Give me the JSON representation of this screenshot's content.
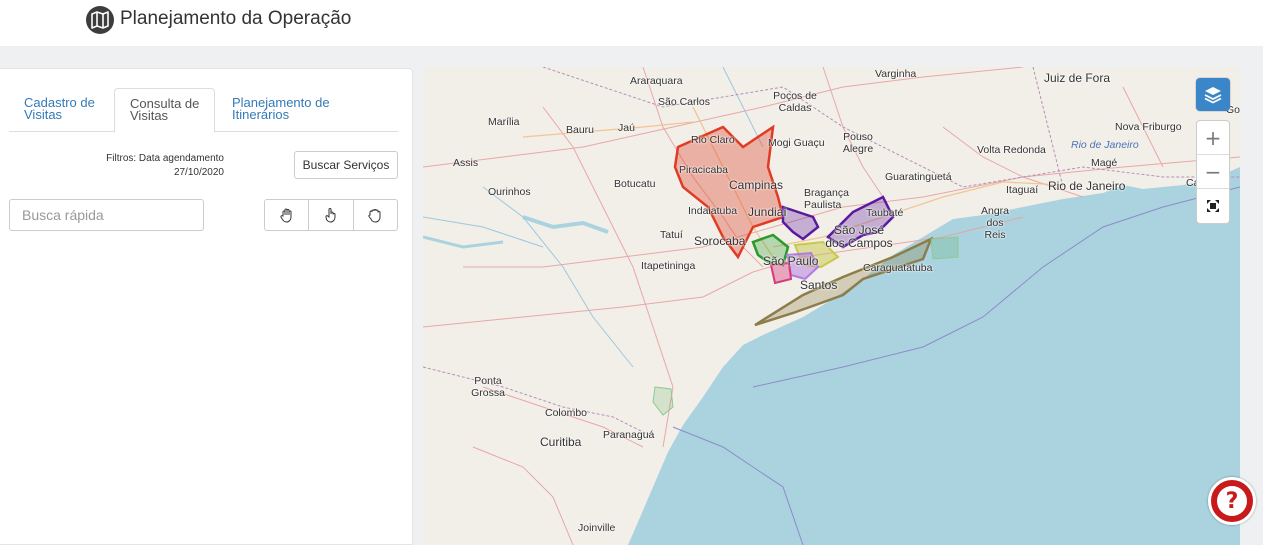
{
  "header": {
    "title": "Planejamento da Operação",
    "logo_icon": "map-book-icon"
  },
  "tabs": [
    {
      "label": "Cadastro de Visitas",
      "active": false
    },
    {
      "label": "Consulta de Visitas",
      "active": true
    },
    {
      "label": "Planejamento de Itinerários",
      "active": false
    }
  ],
  "filters": {
    "label": "Filtros: Data agendamento",
    "date": "27/10/2020"
  },
  "buttons": {
    "buscar_servicos": "Buscar Serviços"
  },
  "search": {
    "placeholder": "Busca rápida",
    "value": ""
  },
  "tool_icons": [
    "hand-open-icon",
    "hand-pointer-icon",
    "hand-grab-icon"
  ],
  "map": {
    "labels": [
      "Varginha",
      "Juiz de Fora",
      "Araraquara",
      "São Carlos",
      "Poços de Caldas",
      "Marília",
      "Bauru",
      "Jaú",
      "Rio Claro",
      "Mogi Guaçu",
      "Pouso Alegre",
      "Nova Friburgo",
      "Volta Redonda",
      "Rio de Janeiro",
      "Magé",
      "Assis",
      "Piracicaba",
      "Campinas",
      "Guaratinguetá",
      "Ourinhos",
      "Botucatu",
      "Bragança Paulista",
      "Itaguaí",
      "Rio de Janeiro",
      "Cabo",
      "Indaiatuba",
      "Jundiaí",
      "Taubaté",
      "Angra dos Reis",
      "Tatuí",
      "São José dos Campos",
      "Sorocaba",
      "Itapetininga",
      "São Paulo",
      "Caraguatatuba",
      "Santos",
      "Ponta Grossa",
      "Colombo",
      "Curitiba",
      "Paranaguá",
      "Joinville",
      "Goy"
    ],
    "zoom_in": "+",
    "zoom_out": "−",
    "colors": {
      "ocean": "#aad3df",
      "land": "#f2efe9",
      "red_region": "#e03b24",
      "purple_region": "#5b1a9e",
      "green_region": "#2a9a2a",
      "olive_region": "#8c7d4a",
      "lilac_region": "#b07ae0",
      "yellow_region": "#c8c84a",
      "pink_region": "#d63a7a",
      "layers_button": "#3a86c8",
      "help_button": "#c81a1a"
    }
  },
  "help": {
    "label": "?"
  }
}
